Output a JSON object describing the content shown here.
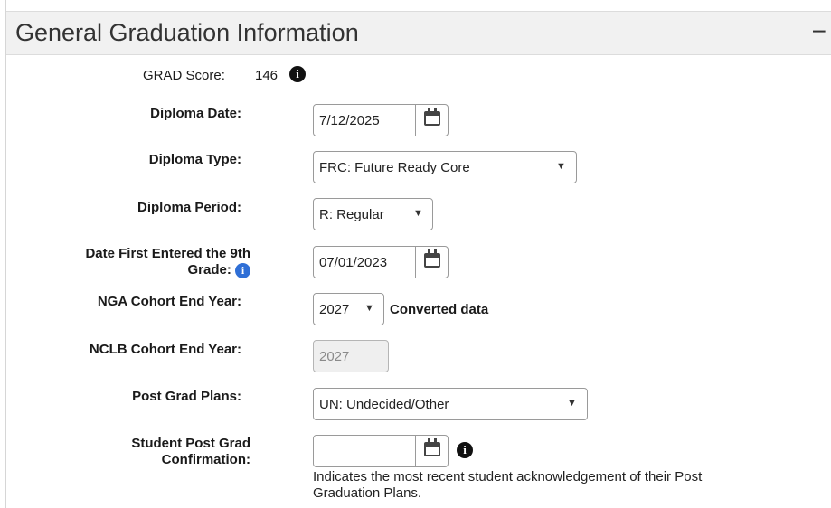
{
  "panel": {
    "title": "General Graduation Information",
    "collapse_glyph": "−"
  },
  "grad_score": {
    "label": "GRAD Score:",
    "value": "146"
  },
  "fields": {
    "diploma_date": {
      "label": "Diploma Date:",
      "value": "7/12/2025"
    },
    "diploma_type": {
      "label": "Diploma Type:",
      "value": "FRC: Future Ready Core"
    },
    "diploma_period": {
      "label": "Diploma Period:",
      "value": "R: Regular"
    },
    "date_first_9th": {
      "label_line1": "Date First Entered the 9th",
      "label_line2": "Grade:",
      "value": "07/01/2023"
    },
    "nga_cohort": {
      "label": "NGA Cohort End Year:",
      "value": "2027",
      "note": "Converted data"
    },
    "nclb_cohort": {
      "label": "NCLB Cohort End Year:",
      "value": "2027"
    },
    "post_grad_plans": {
      "label": "Post Grad Plans:",
      "value": "UN: Undecided/Other"
    },
    "post_grad_confirmation": {
      "label_line1": "Student Post Grad",
      "label_line2": "Confirmation:",
      "value": "",
      "help_line1": "Indicates the most recent student acknowledgement of their Post",
      "help_line2": "Graduation Plans."
    }
  },
  "glyphs": {
    "info": "i",
    "dropdown_arrow": "▼"
  },
  "icons": [
    "calendar-icon",
    "info-icon",
    "chevron-down-icon",
    "collapse-icon"
  ]
}
